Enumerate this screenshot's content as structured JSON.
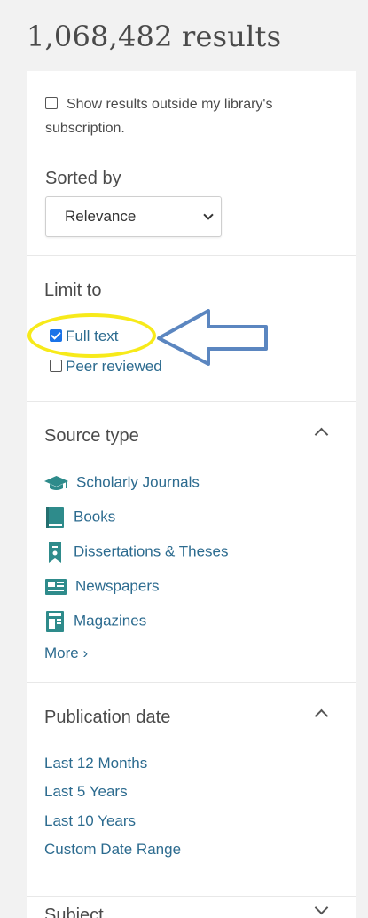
{
  "results": {
    "count_text": "1,068,482 results"
  },
  "filters": {
    "outside_subscription_label": "Show results outside my library's subscription.",
    "sort_label": "Sorted by",
    "sort_value": "Relevance",
    "limit_label": "Limit to",
    "limit_options": [
      {
        "label": "Full text",
        "checked": true
      },
      {
        "label": "Peer reviewed",
        "checked": false
      }
    ]
  },
  "source_type": {
    "title": "Source type",
    "items": [
      {
        "label": "Scholarly Journals",
        "icon": "graduation-cap-icon"
      },
      {
        "label": "Books",
        "icon": "book-icon"
      },
      {
        "label": "Dissertations & Theses",
        "icon": "thesis-icon"
      },
      {
        "label": "Newspapers",
        "icon": "newspaper-icon"
      },
      {
        "label": "Magazines",
        "icon": "magazine-icon"
      }
    ],
    "more_label": "More ›"
  },
  "publication_date": {
    "title": "Publication date",
    "items": [
      "Last 12 Months",
      "Last 5 Years",
      "Last 10 Years",
      "Custom Date Range"
    ]
  },
  "subject": {
    "title": "Subject"
  },
  "colors": {
    "link": "#2c6b8f",
    "icon_teal": "#2e8b8b",
    "checkbox_checked": "#1a73e8",
    "highlight_yellow": "#f7ea1a",
    "arrow_blue": "#5b86c0"
  }
}
